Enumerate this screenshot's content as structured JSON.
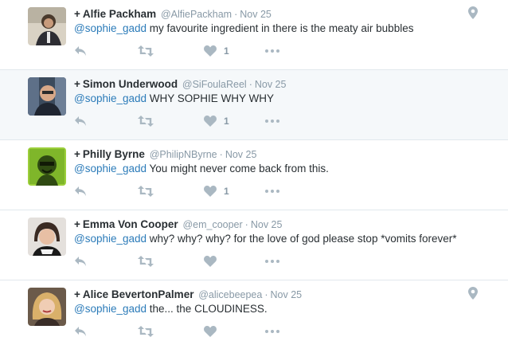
{
  "colors": {
    "link": "#2b7bb9",
    "muted": "#8899a6",
    "icon": "#aab8c2",
    "hover_bg": "#f5f8fa"
  },
  "tweets": [
    {
      "plus": "+",
      "fullname": "Alfie Packham",
      "handle": "@AlfiePackham",
      "sep": "·",
      "time": "Nov 25",
      "mention": "@sophie_gadd",
      "text": " my favourite ingredient in there is the meaty air bubbles",
      "like_count": "1",
      "geo": true,
      "icons": {
        "reply": "reply-icon",
        "retweet": "retweet-icon",
        "like": "heart-icon",
        "more": "more-icon",
        "geo": "location-pin-icon"
      }
    },
    {
      "plus": "+",
      "fullname": "Simon Underwood",
      "handle": "@SiFoulaReel",
      "sep": "·",
      "time": "Nov 25",
      "mention": "@sophie_gadd",
      "text": " WHY SOPHIE WHY WHY",
      "like_count": "1",
      "geo": false
    },
    {
      "plus": "+",
      "fullname": "Philly Byrne",
      "handle": "@PhilipNByrne",
      "sep": "·",
      "time": "Nov 25",
      "mention": "@sophie_gadd",
      "text": " You might never come back from this.",
      "like_count": "1",
      "geo": false
    },
    {
      "plus": "+",
      "fullname": "Emma Von Cooper",
      "handle": "@em_cooper",
      "sep": "·",
      "time": "Nov 25",
      "mention": "@sophie_gadd",
      "text": " why? why? why? for the love of god please stop *vomits forever*",
      "like_count": "",
      "geo": false
    },
    {
      "plus": "+",
      "fullname": "Alice BevertonPalmer",
      "handle": "@alicebeepea",
      "sep": "·",
      "time": "Nov 25",
      "mention": "@sophie_gadd",
      "text": " the... the CLOUDINESS.",
      "like_count": "",
      "geo": true
    }
  ]
}
